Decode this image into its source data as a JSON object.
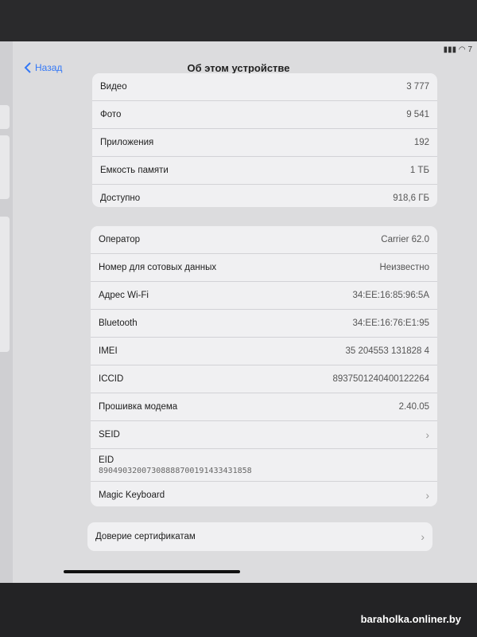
{
  "status": {
    "text": "7"
  },
  "nav": {
    "back_label": "Назад",
    "title": "Об этом устройстве"
  },
  "storage_group": [
    {
      "label": "Видео",
      "value": "3 777"
    },
    {
      "label": "Фото",
      "value": "9 541"
    },
    {
      "label": "Приложения",
      "value": "192"
    },
    {
      "label": "Емкость памяти",
      "value": "1 ТБ"
    },
    {
      "label": "Доступно",
      "value": "918,6 ГБ"
    }
  ],
  "network_group": [
    {
      "label": "Оператор",
      "value": "Carrier 62.0"
    },
    {
      "label": "Номер для сотовых данных",
      "value": "Неизвестно"
    },
    {
      "label": "Адрес Wi-Fi",
      "value": "34:EE:16:85:96:5A"
    },
    {
      "label": "Bluetooth",
      "value": "34:EE:16:76:E1:95"
    },
    {
      "label": "IMEI",
      "value": "35 204553 131828 4"
    },
    {
      "label": "ICCID",
      "value": "8937501240400122264"
    },
    {
      "label": "Прошивка модема",
      "value": "2.40.05"
    },
    {
      "label": "SEID",
      "value": ""
    },
    {
      "label": "EID",
      "value": "89049032007308888700191433431858"
    },
    {
      "label": "Magic Keyboard",
      "value": ""
    }
  ],
  "trust_group": {
    "label": "Доверие сертификатам"
  },
  "watermark": "baraholka.onliner.by"
}
